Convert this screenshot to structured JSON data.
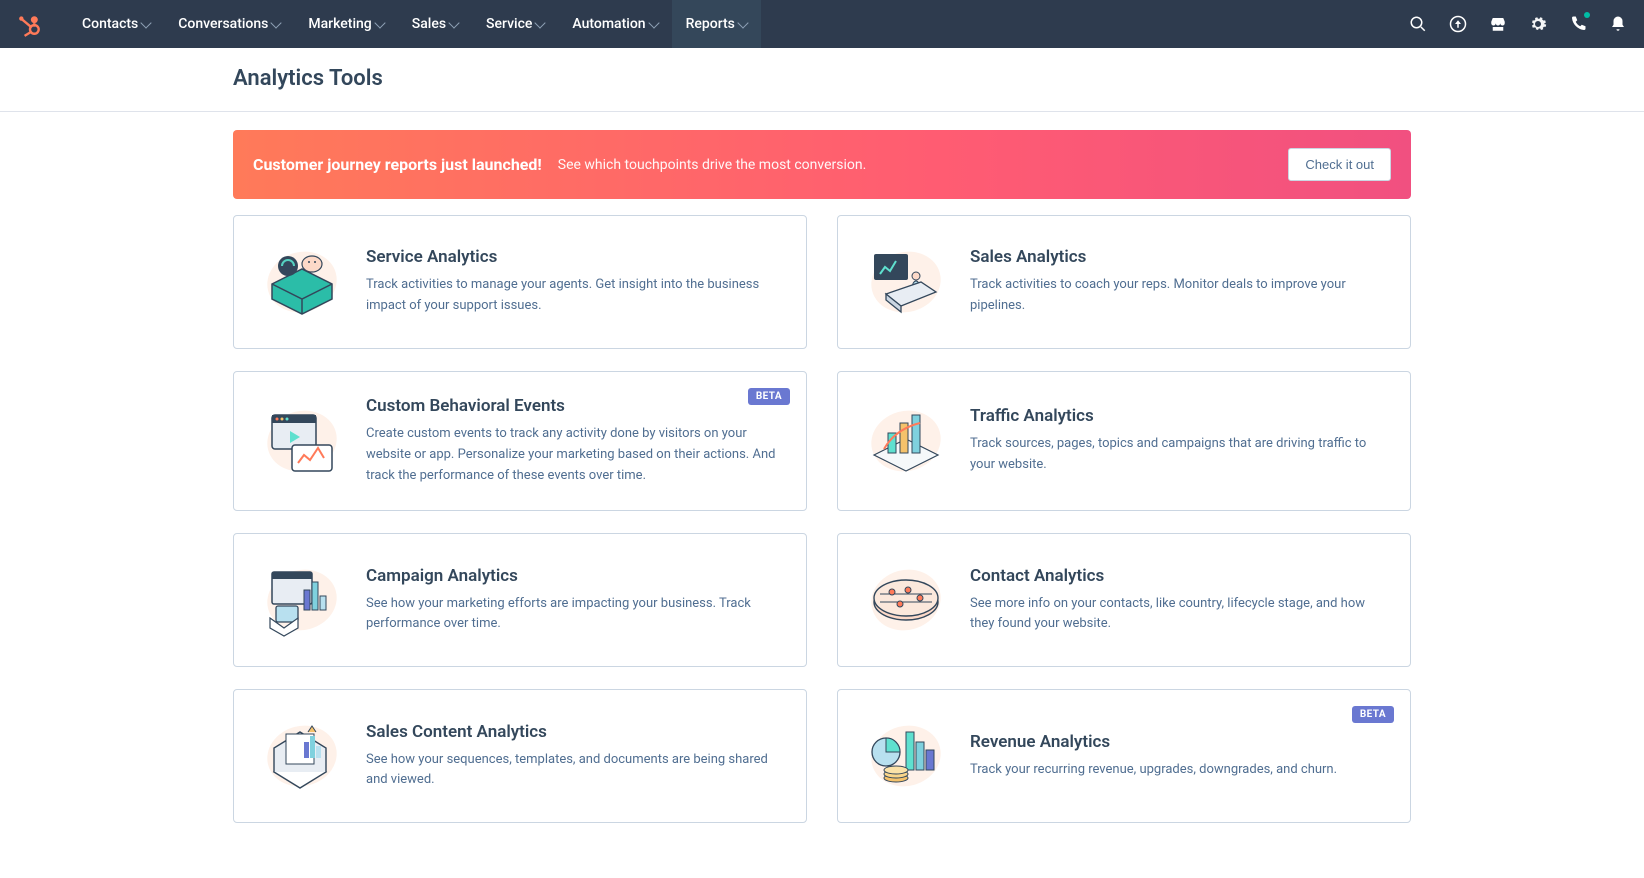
{
  "nav": {
    "items": [
      {
        "label": "Contacts"
      },
      {
        "label": "Conversations"
      },
      {
        "label": "Marketing"
      },
      {
        "label": "Sales"
      },
      {
        "label": "Service"
      },
      {
        "label": "Automation"
      },
      {
        "label": "Reports"
      }
    ]
  },
  "page": {
    "title": "Analytics Tools"
  },
  "banner": {
    "title": "Customer journey reports just launched!",
    "subtitle": "See which touchpoints drive the most conversion.",
    "button": "Check it out"
  },
  "cards": [
    {
      "title": "Service Analytics",
      "desc": "Track activities to manage your agents. Get insight into the business impact of your support issues.",
      "badge": null
    },
    {
      "title": "Sales Analytics",
      "desc": "Track activities to coach your reps. Monitor deals to improve your pipelines.",
      "badge": null
    },
    {
      "title": "Custom Behavioral Events",
      "desc": "Create custom events to track any activity done by visitors on your website or app. Personalize your marketing based on their actions. And track the performance of these events over time.",
      "badge": "BETA"
    },
    {
      "title": "Traffic Analytics",
      "desc": "Track sources, pages, topics and campaigns that are driving traffic to your website.",
      "badge": null
    },
    {
      "title": "Campaign Analytics",
      "desc": "See how your marketing efforts are impacting your business. Track performance over time.",
      "badge": null
    },
    {
      "title": "Contact Analytics",
      "desc": "See more info on your contacts, like country, lifecycle stage, and how they found your website.",
      "badge": null
    },
    {
      "title": "Sales Content Analytics",
      "desc": "See how your sequences, templates, and documents are being shared and viewed.",
      "badge": null
    },
    {
      "title": "Revenue Analytics",
      "desc": "Track your recurring revenue, upgrades, downgrades, and churn.",
      "badge": "BETA"
    }
  ]
}
